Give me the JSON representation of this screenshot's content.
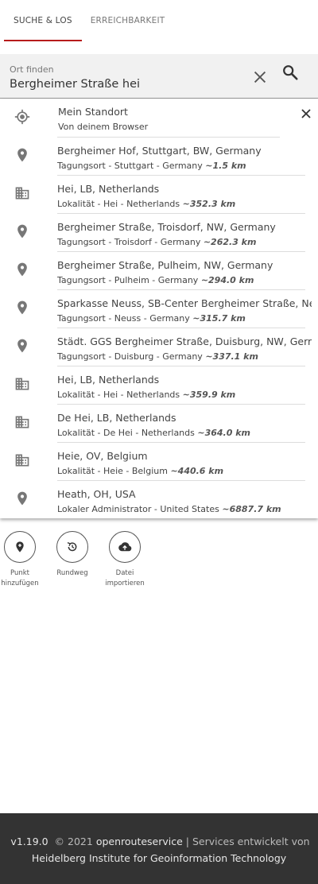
{
  "tabs": [
    {
      "label": "SUCHE & LOS",
      "active": true
    },
    {
      "label": "ERREICHBARKEIT",
      "active": false
    }
  ],
  "search": {
    "label": "Ort finden",
    "value": "Bergheimer Straße hei",
    "placeholder": ""
  },
  "results": [
    {
      "icon": "my-location-icon",
      "title": "Mein Standort",
      "subtitle": "Von deinem Browser",
      "distance": ""
    },
    {
      "icon": "place-pin-icon",
      "title": "Bergheimer Hof, Stuttgart, BW, Germany",
      "subtitle": "Tagungsort - Stuttgart - Germany",
      "distance": "~1.5 km"
    },
    {
      "icon": "city-icon",
      "title": "Hei, LB, Netherlands",
      "subtitle": "Lokalität - Hei - Netherlands",
      "distance": "~352.3 km"
    },
    {
      "icon": "place-pin-icon",
      "title": "Bergheimer Straße, Troisdorf, NW, Germany",
      "subtitle": "Tagungsort - Troisdorf - Germany",
      "distance": "~262.3 km"
    },
    {
      "icon": "place-pin-icon",
      "title": "Bergheimer Straße, Pulheim, NW, Germany",
      "subtitle": "Tagungsort - Pulheim - Germany",
      "distance": "~294.0 km"
    },
    {
      "icon": "place-pin-icon",
      "title": "Sparkasse Neuss, SB-Center Bergheimer Straße, Neuss, NW, Germany",
      "subtitle": "Tagungsort - Neuss - Germany",
      "distance": "~315.7 km"
    },
    {
      "icon": "place-pin-icon",
      "title": "Städt. GGS Bergheimer Straße, Duisburg, NW, Germany",
      "subtitle": "Tagungsort - Duisburg - Germany",
      "distance": "~337.1 km"
    },
    {
      "icon": "city-icon",
      "title": "Hei, LB, Netherlands",
      "subtitle": "Lokalität - Hei - Netherlands",
      "distance": "~359.9 km"
    },
    {
      "icon": "city-icon",
      "title": "De Hei, LB, Netherlands",
      "subtitle": "Lokalität - De Hei - Netherlands",
      "distance": "~364.0 km"
    },
    {
      "icon": "city-icon",
      "title": "Heie, OV, Belgium",
      "subtitle": "Lokalität - Heie - Belgium",
      "distance": "~440.6 km"
    },
    {
      "icon": "place-pin-icon",
      "title": "Heath, OH, USA",
      "subtitle": "Lokaler Administrator - United States",
      "distance": "~6887.7 km"
    }
  ],
  "actions": [
    {
      "icon": "add-place-icon",
      "label_line1": "Punkt",
      "label_line2": "hinzufügen"
    },
    {
      "icon": "roundtrip-icon",
      "label_line1": "Rundweg",
      "label_line2": ""
    },
    {
      "icon": "cloud-upload-icon",
      "label_line1": "Datei",
      "label_line2": "importieren"
    }
  ],
  "footer": {
    "version": "v1.19.0",
    "copyright": "© 2021",
    "brand": "openrouteservice",
    "separator": "|",
    "services_text": "Services entwickelt von",
    "institute": "Heidelberg Institute for Geoinformation Technology"
  },
  "colors": {
    "accent": "#b71c1c",
    "search_bg": "#f1f1f1",
    "footer_bg": "#333333"
  }
}
